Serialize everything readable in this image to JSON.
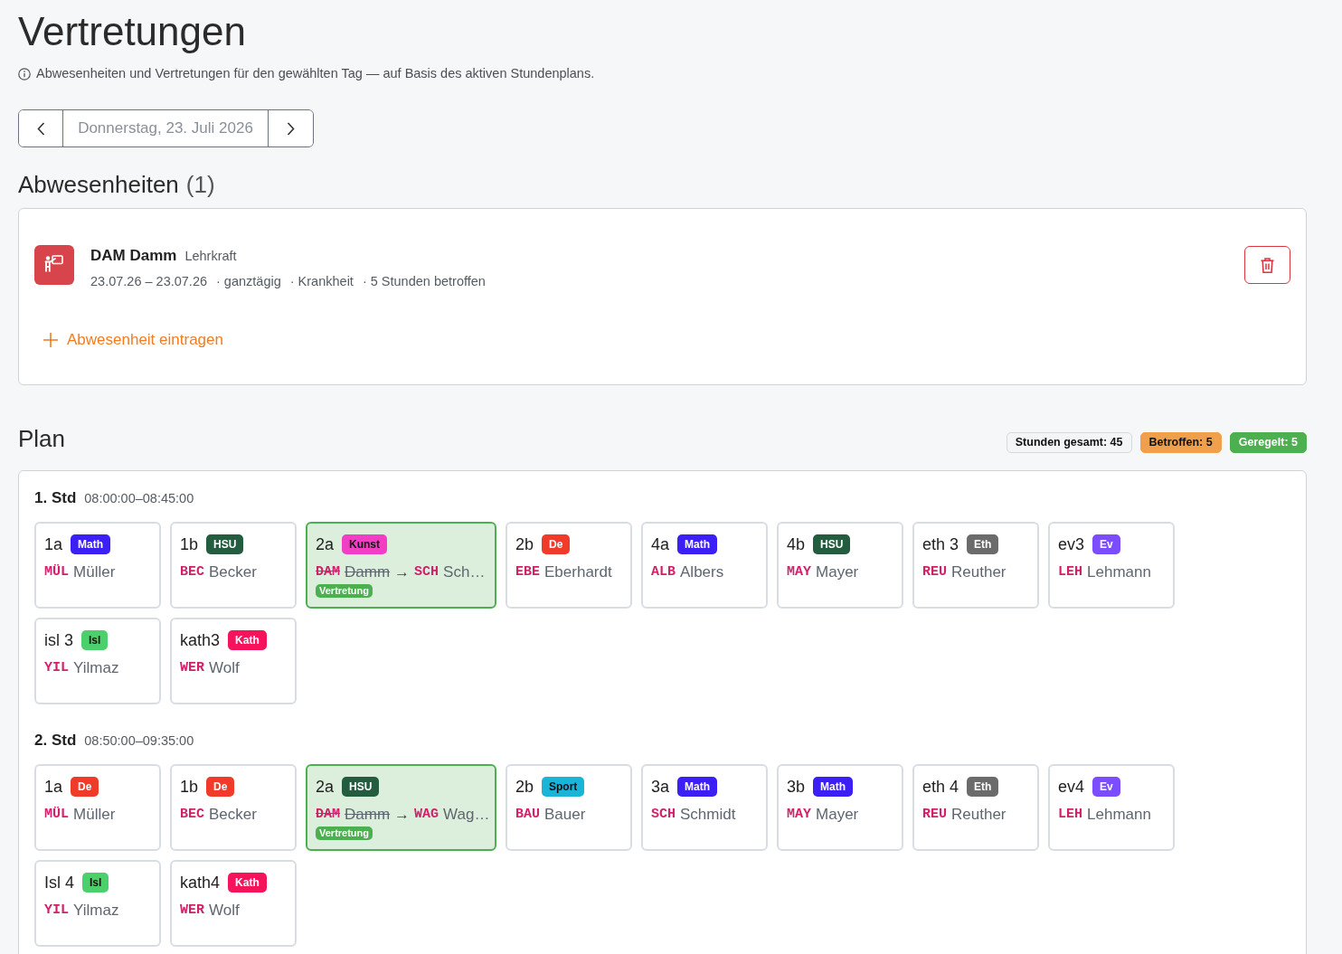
{
  "page": {
    "title": "Vertretungen",
    "subtitle": "Abwesenheiten und Vertretungen für den gewählten Tag — auf Basis des aktiven Stundenplans."
  },
  "date_nav": {
    "label": "Donnerstag, 23. Juli 2026"
  },
  "absences": {
    "heading": "Abwesenheiten",
    "count": "(1)",
    "items": [
      {
        "name": "DAM Damm",
        "role": "Lehrkraft",
        "range": "23.07.26 – 23.07.26",
        "details": [
          "· ganztägig",
          "· Krankheit",
          "· 5 Stunden betroffen"
        ]
      }
    ],
    "add_label": "Abwesenheit eintragen"
  },
  "plan": {
    "heading": "Plan",
    "badges": [
      {
        "label": "Stunden gesamt: 45",
        "kind": "neutral"
      },
      {
        "label": "Betroffen: 5",
        "kind": "warning"
      },
      {
        "label": "Geregelt: 5",
        "kind": "success"
      }
    ],
    "periods": [
      {
        "label": "1. Std",
        "time": "08:00:00–08:45:00",
        "lessons": [
          {
            "kind": "regular",
            "class": "1a",
            "subject": "Math",
            "color": "#3b1ff5",
            "teacher_code": "MÜL",
            "teacher": "Müller"
          },
          {
            "kind": "regular",
            "class": "1b",
            "subject": "HSU",
            "color": "#245c40",
            "teacher_code": "BEC",
            "teacher": "Becker"
          },
          {
            "kind": "substitution",
            "class": "2a",
            "subject": "Kunst",
            "color": "#f23ec4",
            "absent_code": "DAM",
            "absent": "Damm",
            "arrow": "→",
            "teacher_code": "SCH",
            "teacher": "Sch…",
            "tag": "Vertretung"
          },
          {
            "kind": "regular",
            "class": "2b",
            "subject": "De",
            "color": "#f03a2a",
            "teacher_code": "EBE",
            "teacher": "Eberhardt"
          },
          {
            "kind": "regular",
            "class": "4a",
            "subject": "Math",
            "color": "#3b1ff5",
            "teacher_code": "ALB",
            "teacher": "Albers"
          },
          {
            "kind": "regular",
            "class": "4b",
            "subject": "HSU",
            "color": "#245c40",
            "teacher_code": "MAY",
            "teacher": "Mayer"
          },
          {
            "kind": "regular",
            "class": "eth 3",
            "subject": "Eth",
            "color": "#6b6b6b",
            "teacher_code": "REU",
            "teacher": "Reuther"
          },
          {
            "kind": "regular",
            "class": "ev3",
            "subject": "Ev",
            "color": "#7c4dff",
            "teacher_code": "LEH",
            "teacher": "Lehmann"
          },
          {
            "kind": "regular",
            "class": "isl 3",
            "subject": "Isl",
            "color": "#4cd06b",
            "teacher_code": "YIL",
            "teacher": "Yilmaz"
          },
          {
            "kind": "regular",
            "class": "kath3",
            "subject": "Kath",
            "color": "#f5135c",
            "teacher_code": "WER",
            "teacher": "Wolf"
          }
        ]
      },
      {
        "label": "2. Std",
        "time": "08:50:00–09:35:00",
        "lessons": [
          {
            "kind": "regular",
            "class": "1a",
            "subject": "De",
            "color": "#f03a2a",
            "teacher_code": "MÜL",
            "teacher": "Müller"
          },
          {
            "kind": "regular",
            "class": "1b",
            "subject": "De",
            "color": "#f03a2a",
            "teacher_code": "BEC",
            "teacher": "Becker"
          },
          {
            "kind": "substitution",
            "class": "2a",
            "subject": "HSU",
            "color": "#245c40",
            "absent_code": "DAM",
            "absent": "Damm",
            "arrow": "→",
            "teacher_code": "WAG",
            "teacher": "Wag…",
            "tag": "Vertretung"
          },
          {
            "kind": "regular",
            "class": "2b",
            "subject": "Sport",
            "color": "#1ab4d9",
            "teacher_code": "BAU",
            "teacher": "Bauer"
          },
          {
            "kind": "regular",
            "class": "3a",
            "subject": "Math",
            "color": "#3b1ff5",
            "teacher_code": "SCH",
            "teacher": "Schmidt"
          },
          {
            "kind": "regular",
            "class": "3b",
            "subject": "Math",
            "color": "#3b1ff5",
            "teacher_code": "MAY",
            "teacher": "Mayer"
          },
          {
            "kind": "regular",
            "class": "eth 4",
            "subject": "Eth",
            "color": "#6b6b6b",
            "teacher_code": "REU",
            "teacher": "Reuther"
          },
          {
            "kind": "regular",
            "class": "ev4",
            "subject": "Ev",
            "color": "#7c4dff",
            "teacher_code": "LEH",
            "teacher": "Lehmann"
          },
          {
            "kind": "regular",
            "class": "Isl 4",
            "subject": "Isl",
            "color": "#4cd06b",
            "teacher_code": "YIL",
            "teacher": "Yilmaz"
          },
          {
            "kind": "regular",
            "class": "kath4",
            "subject": "Kath",
            "color": "#f5135c",
            "teacher_code": "WER",
            "teacher": "Wolf"
          }
        ]
      }
    ]
  }
}
